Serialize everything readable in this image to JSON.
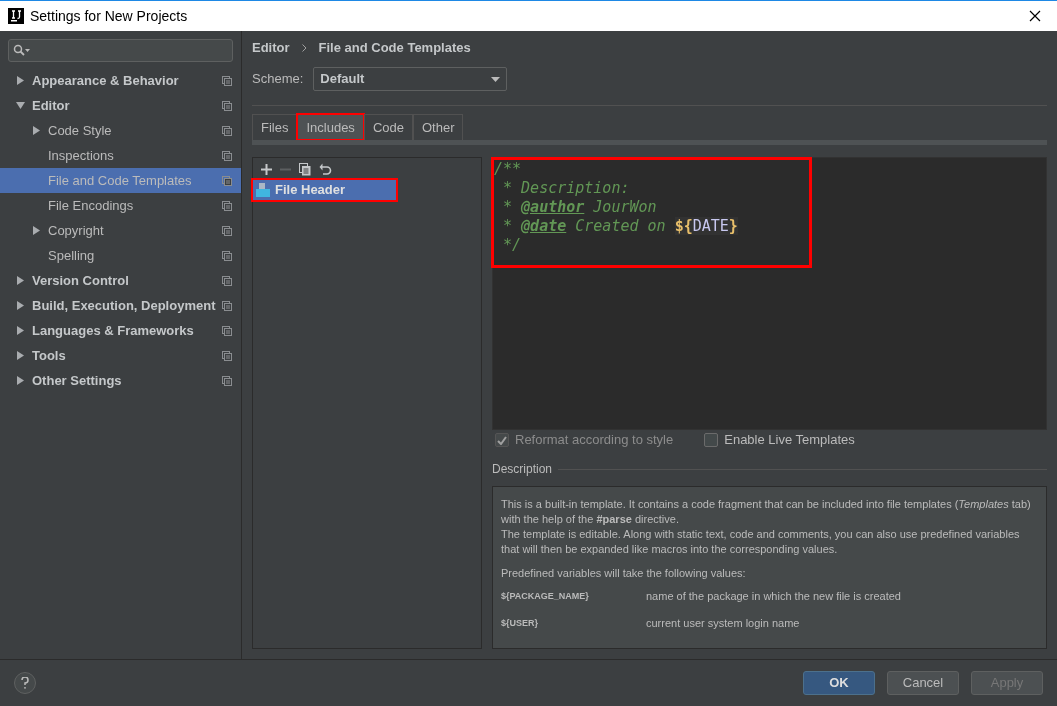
{
  "window": {
    "title": "Settings for New Projects"
  },
  "sidebar": {
    "items": [
      {
        "label": "Appearance & Behavior",
        "bold": true,
        "expanded": false,
        "selected": false
      },
      {
        "label": "Editor",
        "bold": true,
        "expanded": true,
        "selected": false,
        "children": [
          {
            "label": "Code Style",
            "bold": false,
            "expanded": false,
            "selected": false
          },
          {
            "label": "Inspections",
            "bold": false,
            "selected": false
          },
          {
            "label": "File and Code Templates",
            "bold": false,
            "selected": true
          },
          {
            "label": "File Encodings",
            "bold": false,
            "selected": false
          },
          {
            "label": "Copyright",
            "bold": false,
            "expanded": false,
            "selected": false
          },
          {
            "label": "Spelling",
            "bold": false,
            "selected": false
          }
        ]
      },
      {
        "label": "Version Control",
        "bold": true,
        "expanded": false,
        "selected": false
      },
      {
        "label": "Build, Execution, Deployment",
        "bold": true,
        "expanded": false,
        "selected": false
      },
      {
        "label": "Languages & Frameworks",
        "bold": true,
        "expanded": false,
        "selected": false
      },
      {
        "label": "Tools",
        "bold": true,
        "expanded": false,
        "selected": false
      },
      {
        "label": "Other Settings",
        "bold": true,
        "expanded": false,
        "selected": false
      }
    ]
  },
  "breadcrumb": [
    "Editor",
    "File and Code Templates"
  ],
  "scheme": {
    "label": "Scheme:",
    "value": "Default"
  },
  "tabs": [
    {
      "label": "Files",
      "selected": false,
      "highlighted": false
    },
    {
      "label": "Includes",
      "selected": true,
      "highlighted": true
    },
    {
      "label": "Code",
      "selected": false,
      "highlighted": false
    },
    {
      "label": "Other",
      "selected": false,
      "highlighted": false
    }
  ],
  "templates": [
    {
      "label": "File Header",
      "selected": true,
      "highlighted": true
    }
  ],
  "editor": {
    "highlighted": true,
    "lines": [
      [
        {
          "kind": "comment",
          "text": "/**"
        }
      ],
      [
        {
          "kind": "comment",
          "text": " * Description:"
        }
      ],
      [
        {
          "kind": "comment",
          "text": " * "
        },
        {
          "kind": "tag",
          "text": "@author"
        },
        {
          "kind": "comment",
          "text": " JourWon"
        }
      ],
      [
        {
          "kind": "comment",
          "text": " * "
        },
        {
          "kind": "tag",
          "text": "@date"
        },
        {
          "kind": "comment",
          "text": " Created on "
        },
        {
          "kind": "brace",
          "text": "${"
        },
        {
          "kind": "variable",
          "text": "DATE"
        },
        {
          "kind": "brace",
          "text": "}"
        }
      ],
      [
        {
          "kind": "comment",
          "text": " */"
        }
      ]
    ]
  },
  "options": [
    {
      "label": "Reformat according to style",
      "checked": true,
      "disabled": true
    },
    {
      "label": "Enable Live Templates",
      "checked": false,
      "disabled": false
    }
  ],
  "description": {
    "title": "Description",
    "paragraphs": [
      "This is a built-in template. It contains a code fragment that can be included into file templates (*Templates* tab) with the help of the **#parse** directive.",
      "The template is editable. Along with static text, code and comments, you can also use predefined variables that will then be expanded like macros into the corresponding values.",
      "Predefined variables will take the following values:"
    ],
    "variables": [
      {
        "name": "${PACKAGE_NAME}",
        "meaning": "name of the package in which the new file is created"
      },
      {
        "name": "${USER}",
        "meaning": "current user system login name"
      }
    ]
  },
  "buttons": [
    {
      "label": "OK",
      "kind": "primary",
      "disabled": false
    },
    {
      "label": "Cancel",
      "kind": "normal",
      "disabled": false
    },
    {
      "label": "Apply",
      "kind": "normal",
      "disabled": true
    }
  ]
}
